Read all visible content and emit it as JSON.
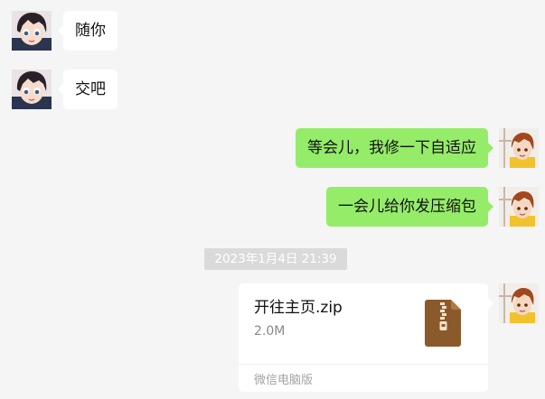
{
  "messages": [
    {
      "direction": "incoming",
      "text": "随你"
    },
    {
      "direction": "incoming",
      "text": "交吧"
    },
    {
      "direction": "outgoing",
      "text": "等会儿，我修一下自适应"
    },
    {
      "direction": "outgoing",
      "text": "一会儿给你发压缩包"
    }
  ],
  "timestamp": "2023年1月4日 21:39",
  "file_message": {
    "name": "开往主页.zip",
    "size": "2.0M",
    "source": "微信电脑版",
    "icon": "zip-file-icon"
  },
  "colors": {
    "background": "#f5f5f5",
    "incoming_bubble": "#ffffff",
    "outgoing_bubble": "#95ec69",
    "zip_icon": "#8b5a2b"
  }
}
